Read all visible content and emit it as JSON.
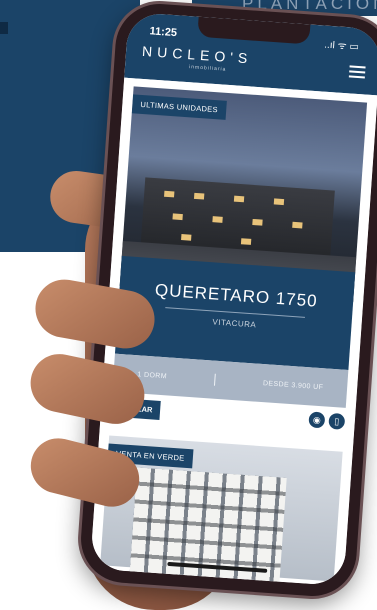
{
  "banner_text": "PLANTACIÓN",
  "status": {
    "time": "11:25",
    "icons": "..ıl ᯤ ▭"
  },
  "app": {
    "logo": "NUCLEO'S",
    "logo_sub": "inmobiliaria"
  },
  "listing1": {
    "tag": "ULTIMAS UNIDADES",
    "name": "QUERETARO 1750",
    "location": "VITACURA",
    "info_left": "1 DORM",
    "info_right": "DESDE 3.900 UF"
  },
  "actions": {
    "quote_label": "COTIZAR",
    "whatsapp_icon": "whatsapp-icon",
    "phone_icon": "phone-icon"
  },
  "listing2": {
    "tag": "VENTA EN VERDE"
  },
  "colors": {
    "brand": "#1b4468",
    "info_bar": "#a8b4c4"
  }
}
